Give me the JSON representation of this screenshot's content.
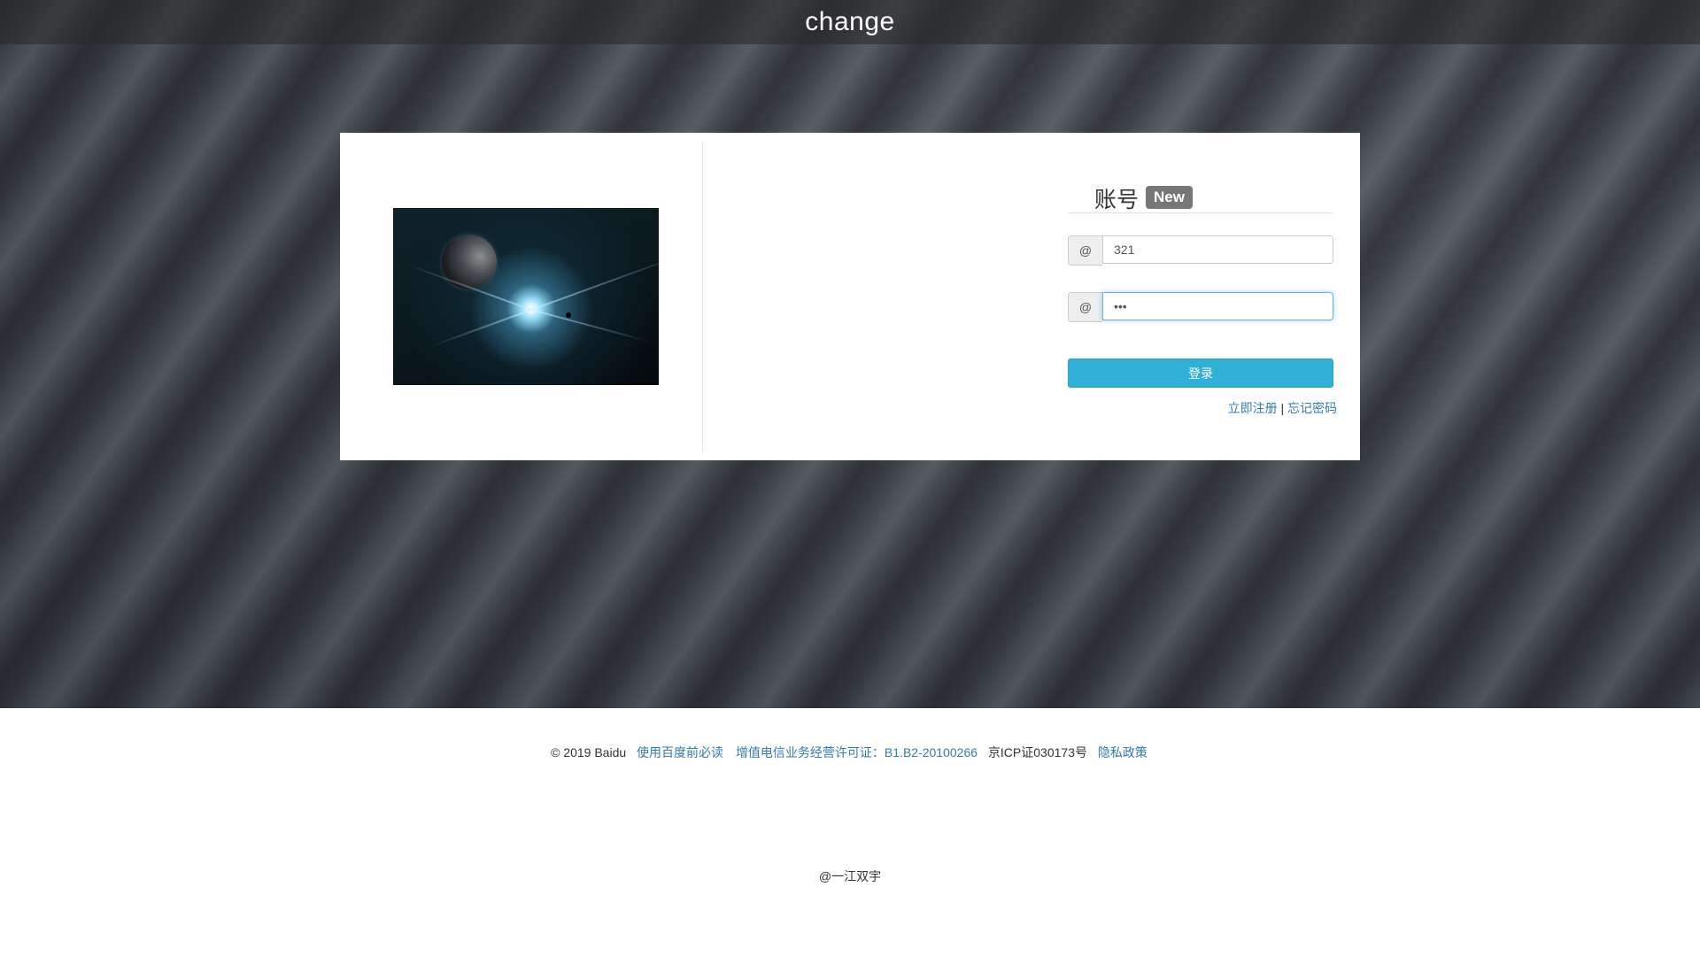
{
  "header": {
    "title": "change"
  },
  "login": {
    "heading": "账号",
    "badge": "New",
    "username": {
      "addon": "@",
      "value": "321"
    },
    "password": {
      "addon": "@",
      "value": "•••"
    },
    "submit_label": "登录",
    "register_link": "立即注册",
    "separator": "|",
    "forgot_link": "忘记密码"
  },
  "footer": {
    "copyright": "© 2019 Baidu",
    "terms_link": "使用百度前必读",
    "license_link": "增值电信业务经营许可证：B1.B2-20100266",
    "icp": "京ICP证030173号",
    "privacy_link": "隐私政策",
    "author": "@一江双宇"
  },
  "colors": {
    "primary_button": "#31b0d5",
    "link": "#337ab7",
    "badge": "#777777"
  },
  "icons": {
    "illustration": "space-planet-image"
  }
}
